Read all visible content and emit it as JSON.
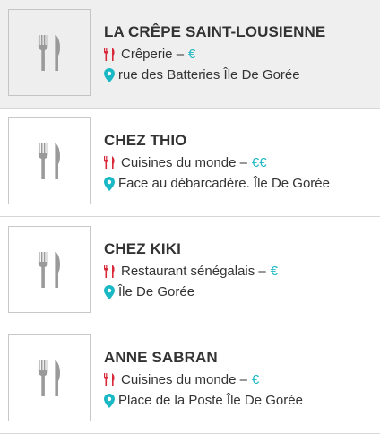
{
  "icons": {
    "thumbnail": "fork-knife-icon",
    "category": "fork-knife-icon",
    "address": "map-pin-icon"
  },
  "colors": {
    "price": "#1ab8c4",
    "category_icon": "#d9283a",
    "address_icon": "#1ab8c4",
    "selected_background": "#efefef"
  },
  "restaurants": [
    {
      "name": "LA CRÊPE SAINT-LOUSIENNE",
      "category": "Crêperie –",
      "price": "€",
      "address": "rue des Batteries Île De Gorée"
    },
    {
      "name": "CHEZ THIO",
      "category": "Cuisines du monde –",
      "price": "€€",
      "address": "Face au débarcadère. Île De Gorée"
    },
    {
      "name": "CHEZ KIKI",
      "category": "Restaurant sénégalais –",
      "price": "€",
      "address": "Île De Gorée"
    },
    {
      "name": "ANNE SABRAN",
      "category": "Cuisines du monde –",
      "price": "€",
      "address": "Place de la Poste Île De Gorée"
    }
  ]
}
